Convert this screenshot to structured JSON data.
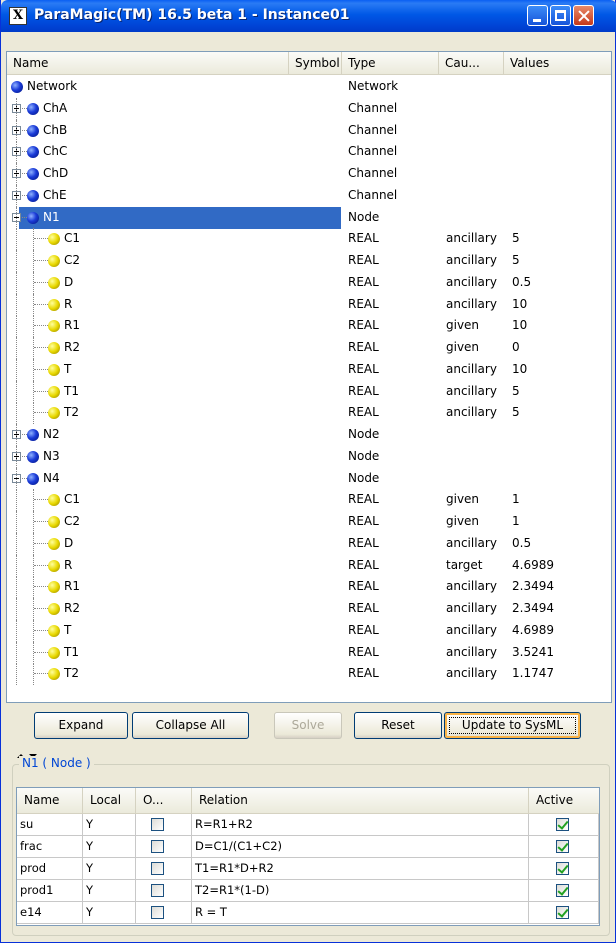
{
  "window": {
    "title": "ParaMagic(TM) 16.5 beta 1 - Instance01",
    "app_icon": "X"
  },
  "tree": {
    "columns": [
      "Name",
      "Symbol",
      "Type",
      "Cau...",
      "Values"
    ],
    "rows": [
      {
        "name": "Network",
        "type": "Network",
        "cause": "",
        "value": "",
        "level": 0,
        "icon": "blue",
        "expander": "none"
      },
      {
        "name": "ChA",
        "type": "Channel",
        "cause": "",
        "value": "",
        "level": 1,
        "icon": "blue",
        "expander": "plus"
      },
      {
        "name": "ChB",
        "type": "Channel",
        "cause": "",
        "value": "",
        "level": 1,
        "icon": "blue",
        "expander": "plus"
      },
      {
        "name": "ChC",
        "type": "Channel",
        "cause": "",
        "value": "",
        "level": 1,
        "icon": "blue",
        "expander": "plus"
      },
      {
        "name": "ChD",
        "type": "Channel",
        "cause": "",
        "value": "",
        "level": 1,
        "icon": "blue",
        "expander": "plus"
      },
      {
        "name": "ChE",
        "type": "Channel",
        "cause": "",
        "value": "",
        "level": 1,
        "icon": "blue",
        "expander": "plus"
      },
      {
        "name": "N1",
        "type": "Node",
        "cause": "",
        "value": "",
        "level": 1,
        "icon": "blue",
        "expander": "minus",
        "selected": true
      },
      {
        "name": "C1",
        "type": "REAL",
        "cause": "ancillary",
        "value": "5",
        "level": 2,
        "icon": "yellow"
      },
      {
        "name": "C2",
        "type": "REAL",
        "cause": "ancillary",
        "value": "5",
        "level": 2,
        "icon": "yellow"
      },
      {
        "name": "D",
        "type": "REAL",
        "cause": "ancillary",
        "value": "0.5",
        "level": 2,
        "icon": "yellow"
      },
      {
        "name": "R",
        "type": "REAL",
        "cause": "ancillary",
        "value": "10",
        "level": 2,
        "icon": "yellow"
      },
      {
        "name": "R1",
        "type": "REAL",
        "cause": "given",
        "value": "10",
        "level": 2,
        "icon": "yellow"
      },
      {
        "name": "R2",
        "type": "REAL",
        "cause": "given",
        "value": "0",
        "level": 2,
        "icon": "yellow"
      },
      {
        "name": "T",
        "type": "REAL",
        "cause": "ancillary",
        "value": "10",
        "level": 2,
        "icon": "yellow"
      },
      {
        "name": "T1",
        "type": "REAL",
        "cause": "ancillary",
        "value": "5",
        "level": 2,
        "icon": "yellow"
      },
      {
        "name": "T2",
        "type": "REAL",
        "cause": "ancillary",
        "value": "5",
        "level": 2,
        "icon": "yellow"
      },
      {
        "name": "N2",
        "type": "Node",
        "cause": "",
        "value": "",
        "level": 1,
        "icon": "blue",
        "expander": "plus"
      },
      {
        "name": "N3",
        "type": "Node",
        "cause": "",
        "value": "",
        "level": 1,
        "icon": "blue",
        "expander": "plus"
      },
      {
        "name": "N4",
        "type": "Node",
        "cause": "",
        "value": "",
        "level": 1,
        "icon": "blue",
        "expander": "minus"
      },
      {
        "name": "C1",
        "type": "REAL",
        "cause": "given",
        "value": "1",
        "level": 2,
        "icon": "yellow"
      },
      {
        "name": "C2",
        "type": "REAL",
        "cause": "given",
        "value": "1",
        "level": 2,
        "icon": "yellow"
      },
      {
        "name": "D",
        "type": "REAL",
        "cause": "ancillary",
        "value": "0.5",
        "level": 2,
        "icon": "yellow"
      },
      {
        "name": "R",
        "type": "REAL",
        "cause": "target",
        "value": "4.6989",
        "level": 2,
        "icon": "yellow"
      },
      {
        "name": "R1",
        "type": "REAL",
        "cause": "ancillary",
        "value": "2.3494",
        "level": 2,
        "icon": "yellow"
      },
      {
        "name": "R2",
        "type": "REAL",
        "cause": "ancillary",
        "value": "2.3494",
        "level": 2,
        "icon": "yellow"
      },
      {
        "name": "T",
        "type": "REAL",
        "cause": "ancillary",
        "value": "4.6989",
        "level": 2,
        "icon": "yellow"
      },
      {
        "name": "T1",
        "type": "REAL",
        "cause": "ancillary",
        "value": "3.5241",
        "level": 2,
        "icon": "yellow"
      },
      {
        "name": "T2",
        "type": "REAL",
        "cause": "ancillary",
        "value": "1.1747",
        "level": 2,
        "icon": "yellow"
      }
    ]
  },
  "buttons": {
    "expand": "Expand",
    "collapse_all": "Collapse All",
    "solve": "Solve",
    "reset": "Reset",
    "update": "Update to SysML"
  },
  "details": {
    "group_title": "N1 ( Node )",
    "columns": [
      "Name",
      "Local",
      "O...",
      "Relation",
      "Active"
    ],
    "rows": [
      {
        "name": "su",
        "local": "Y",
        "o": false,
        "relation": "R=R1+R2",
        "active": true
      },
      {
        "name": "frac",
        "local": "Y",
        "o": false,
        "relation": "D=C1/(C1+C2)",
        "active": true
      },
      {
        "name": "prod",
        "local": "Y",
        "o": false,
        "relation": "T1=R1*D+R2",
        "active": true
      },
      {
        "name": "prod1",
        "local": "Y",
        "o": false,
        "relation": "T2=R1*(1-D)",
        "active": true
      },
      {
        "name": "e14",
        "local": "Y",
        "o": false,
        "relation": "R = T",
        "active": true
      }
    ]
  },
  "colors": {
    "selection": "#316ac5",
    "title_bar": "#0058e6",
    "group_title": "#0046d5"
  }
}
